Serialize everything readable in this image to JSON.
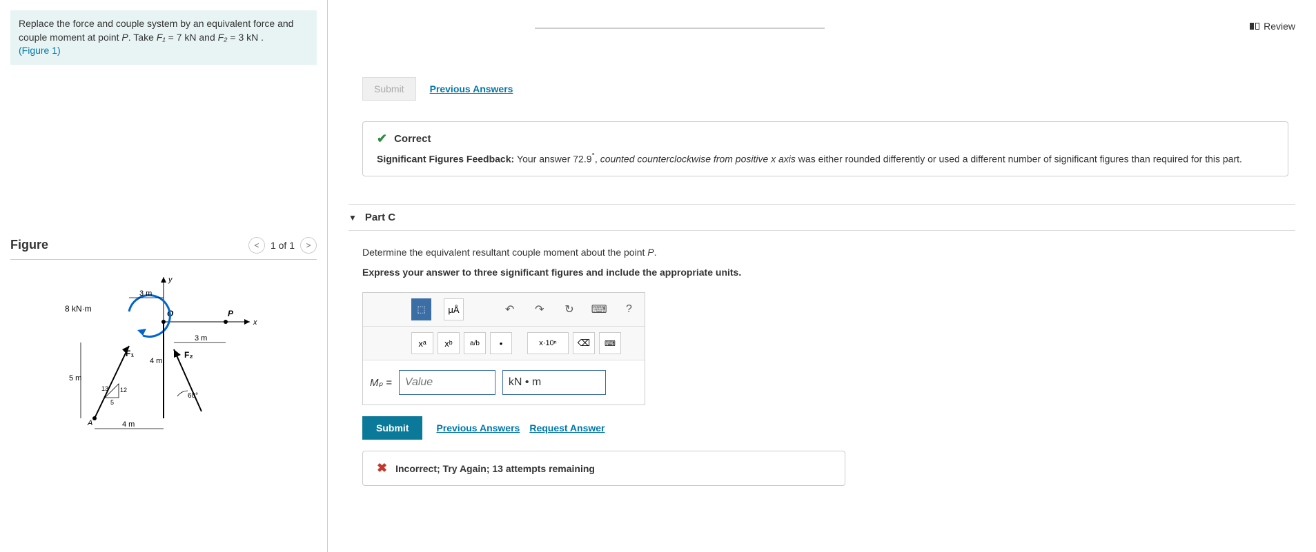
{
  "review": {
    "label": "Review"
  },
  "problem": {
    "text_prefix": "Replace the force and couple system by an equivalent force and couple moment at point ",
    "point": "P",
    "take_text": ". Take ",
    "f1_label": "F₁",
    "f1_value": " = 7 kN",
    "and_text": " and ",
    "f2_label": "F₂",
    "f2_value": " = 3 kN .",
    "figure_ref": "(Figure 1)"
  },
  "figure": {
    "title": "Figure",
    "nav_prev": "<",
    "nav_count": "1 of 1",
    "nav_next": ">",
    "labels": {
      "moment": "8 kN·m",
      "dist_3m_a": "3 m",
      "dist_3m_b": "3 m",
      "dist_4m_a": "4 m",
      "dist_4m_b": "4 m",
      "dist_5m": "5 m",
      "f1": "F₁",
      "f2": "F₂",
      "angle": "60°",
      "tri_13": "13",
      "tri_12": "12",
      "tri_5": "5",
      "axis_x": "x",
      "axis_y": "y",
      "point_o": "O",
      "point_p": "P",
      "point_a": "A"
    }
  },
  "prev_submit": {
    "submit_label": "Submit",
    "previous_answers": "Previous Answers"
  },
  "feedback_correct": {
    "status": "Correct",
    "sig_label": "Significant Figures Feedback: ",
    "your_answer_prefix": "Your answer ",
    "value": "72.9",
    "degree": "°",
    "comma_text": ", ",
    "italic_text": "counted counterclockwise from positive x axis",
    "tail_text": " was either rounded differently or used a different number of significant figures than required for this part."
  },
  "part_c": {
    "title": "Part C",
    "question_prefix": "Determine the equivalent resultant couple moment about the point ",
    "point": "P",
    "question_suffix": ".",
    "instruction": "Express your answer to three significant figures and include the appropriate units.",
    "answer_label": "Mₚ =",
    "value_placeholder": "Value",
    "units": "kN • m",
    "toolbar": {
      "templates": "⬚",
      "units_btn": "μÅ",
      "undo": "↶",
      "redo": "↷",
      "reset": "↻",
      "keyboard": "⌨",
      "help": "?",
      "sup": "xᵃ",
      "sub": "xᵇ",
      "frac": "a/b",
      "dot": "•",
      "sci": "x·10ⁿ",
      "backspace": "⌫"
    },
    "submit_label": "Submit",
    "previous_answers": "Previous Answers",
    "request_answer": "Request Answer"
  },
  "error": {
    "text": "Incorrect; Try Again; 13 attempts remaining"
  }
}
